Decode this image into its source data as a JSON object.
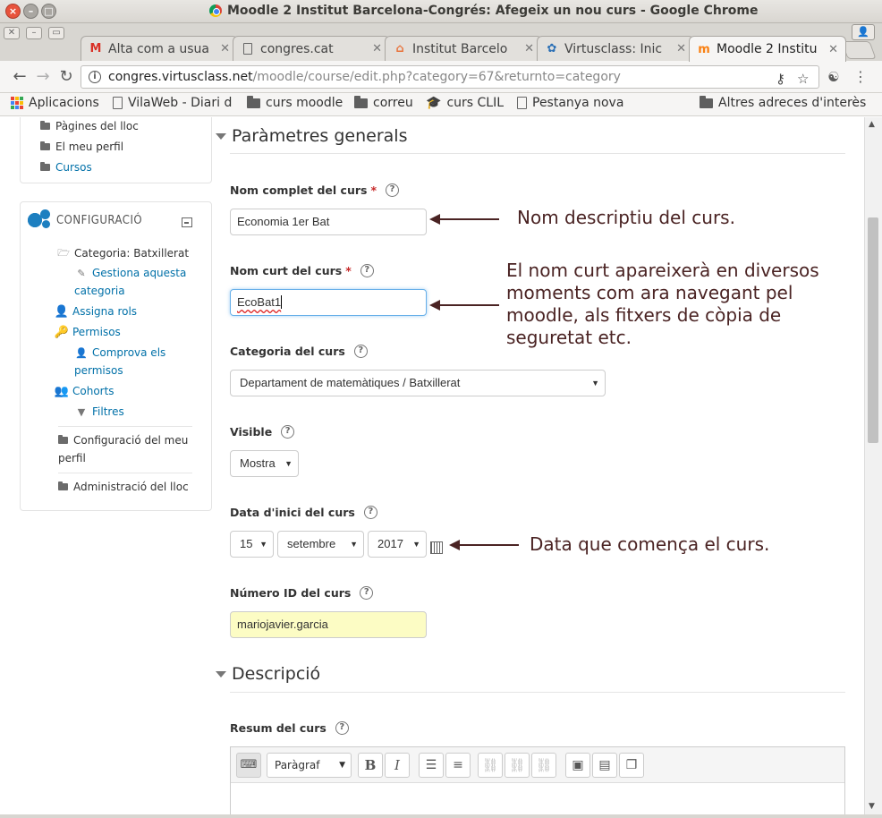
{
  "window": {
    "title": "Moodle 2 Institut Barcelona-Congrés: Afegeix un nou curs - Google Chrome"
  },
  "tabs": [
    {
      "label": "Alta com a usua",
      "icon": "gmail-icon"
    },
    {
      "label": "congres.cat",
      "icon": "page-icon"
    },
    {
      "label": "Institut Barcelo",
      "icon": "site-icon"
    },
    {
      "label": "Virtusclass: Inic",
      "icon": "paw-icon"
    },
    {
      "label": "Moodle 2 Institu",
      "icon": "moodle-icon",
      "active": true
    }
  ],
  "address": {
    "host": "congres.virtusclass.net",
    "path": "/moodle/course/edit.php?category=67&returnto=category"
  },
  "bookmarks": [
    {
      "label": "Aplicacions",
      "icon": "apps-icon"
    },
    {
      "label": "VilaWeb - Diari d",
      "icon": "page-icon"
    },
    {
      "label": "curs moodle",
      "icon": "folder-icon"
    },
    {
      "label": "correu",
      "icon": "folder-icon"
    },
    {
      "label": "curs CLIL",
      "icon": "cap-icon"
    },
    {
      "label": "Pestanya nova",
      "icon": "page-icon"
    },
    {
      "label": "Altres adreces d'interès",
      "icon": "folder-icon"
    }
  ],
  "nav": {
    "items": [
      "Pàgines del lloc",
      "El meu perfil",
      "Cursos"
    ]
  },
  "config": {
    "title": "CONFIGURACIÓ",
    "category": "Categoria: Batxillerat",
    "manage": [
      "Gestiona aquesta",
      "categoria"
    ],
    "assign_roles": "Assigna rols",
    "permissions": "Permisos",
    "check_perms": [
      "Comprova els",
      "permisos"
    ],
    "cohorts": "Cohorts",
    "filters": "Filtres",
    "profile_settings": [
      "Configuració del meu",
      "perfil"
    ],
    "site_admin": "Administració del lloc"
  },
  "form": {
    "general_header": "Paràmetres generals",
    "fullname_label": "Nom complet del curs",
    "fullname_value": "Economia 1er Bat",
    "shortname_label": "Nom curt del curs",
    "shortname_value": "EcoBat1",
    "category_label": "Categoria del curs",
    "category_value": "Departament de matemàtiques / Batxillerat",
    "visible_label": "Visible",
    "visible_value": "Mostra",
    "startdate_label": "Data d'inici del curs",
    "start_day": "15",
    "start_month": "setembre",
    "start_year": "2017",
    "idnumber_label": "Número ID del curs",
    "idnumber_value": "mariojavier.garcia",
    "description_header": "Descripció",
    "summary_label": "Resum del curs",
    "editor_format": "Paràgraf"
  },
  "annotations": {
    "fullname": "Nom descriptiu del curs.",
    "shortname": [
      "El nom curt apareixerà en diversos",
      "moments com ara navegant pel",
      "moodle, als fitxers de còpia de",
      "seguretat etc."
    ],
    "startdate": "Data que comença el curs."
  },
  "colors": {
    "link": "#0070a8",
    "required": "#c62828",
    "annotation": "#4a2323",
    "config_icon": "#1d7fc0"
  }
}
